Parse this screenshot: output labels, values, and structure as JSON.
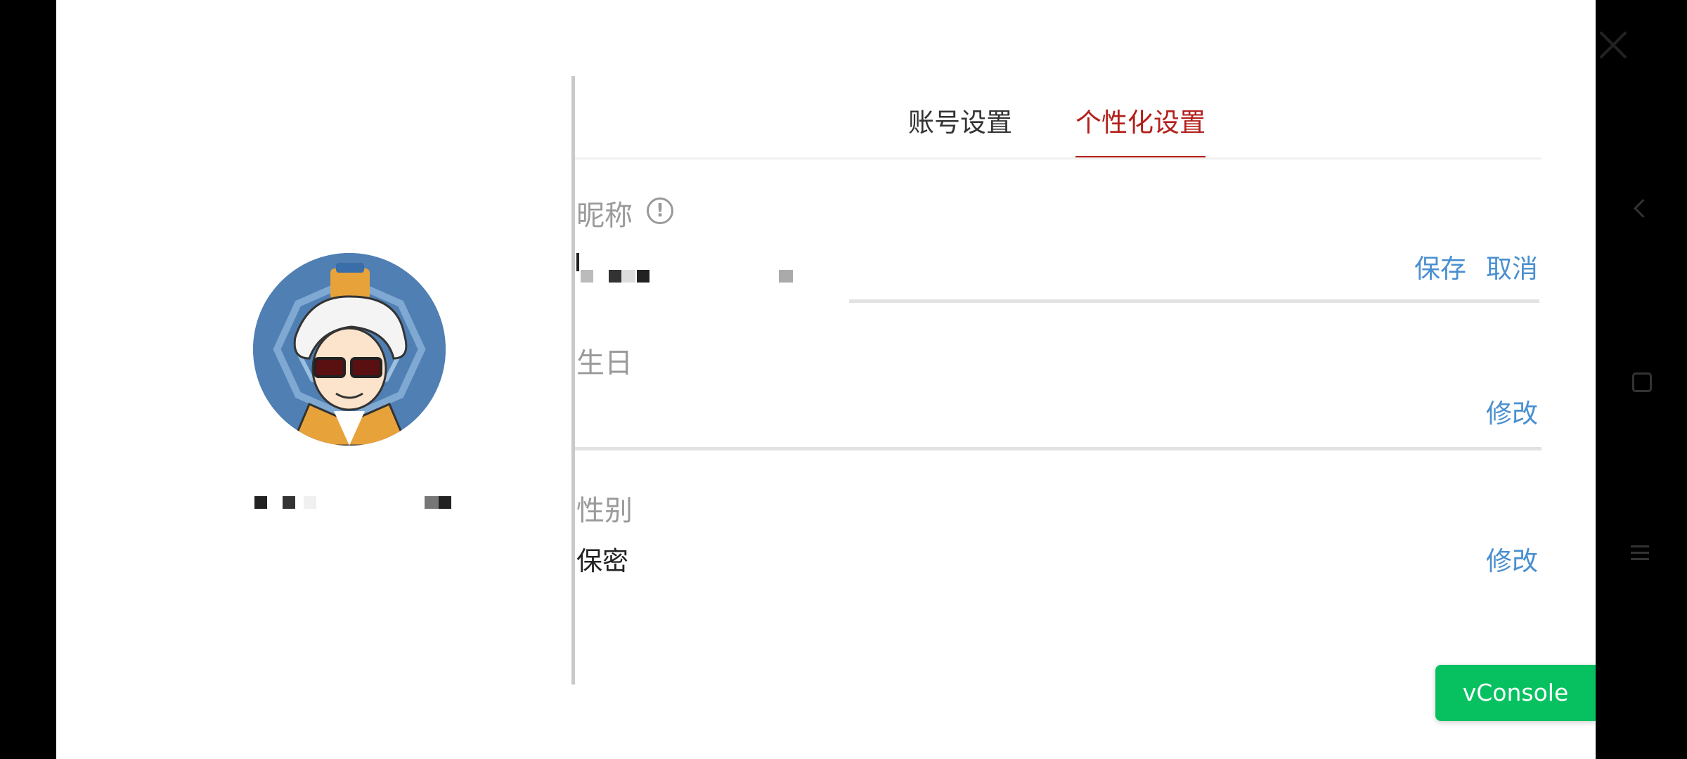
{
  "tabs": [
    {
      "label": "账号设置",
      "active": false
    },
    {
      "label": "个性化设置",
      "active": true
    }
  ],
  "fields": {
    "nickname": {
      "label": "昵称",
      "value": "",
      "save_label": "保存",
      "cancel_label": "取消"
    },
    "birthday": {
      "label": "生日",
      "value": "",
      "edit_label": "修改"
    },
    "gender": {
      "label": "性别",
      "value": "保密",
      "edit_label": "修改"
    }
  },
  "vconsole": {
    "label": "vConsole"
  },
  "colors": {
    "accent": "#b3201b",
    "link": "#4a8fd0",
    "vconsole": "#07c160"
  }
}
